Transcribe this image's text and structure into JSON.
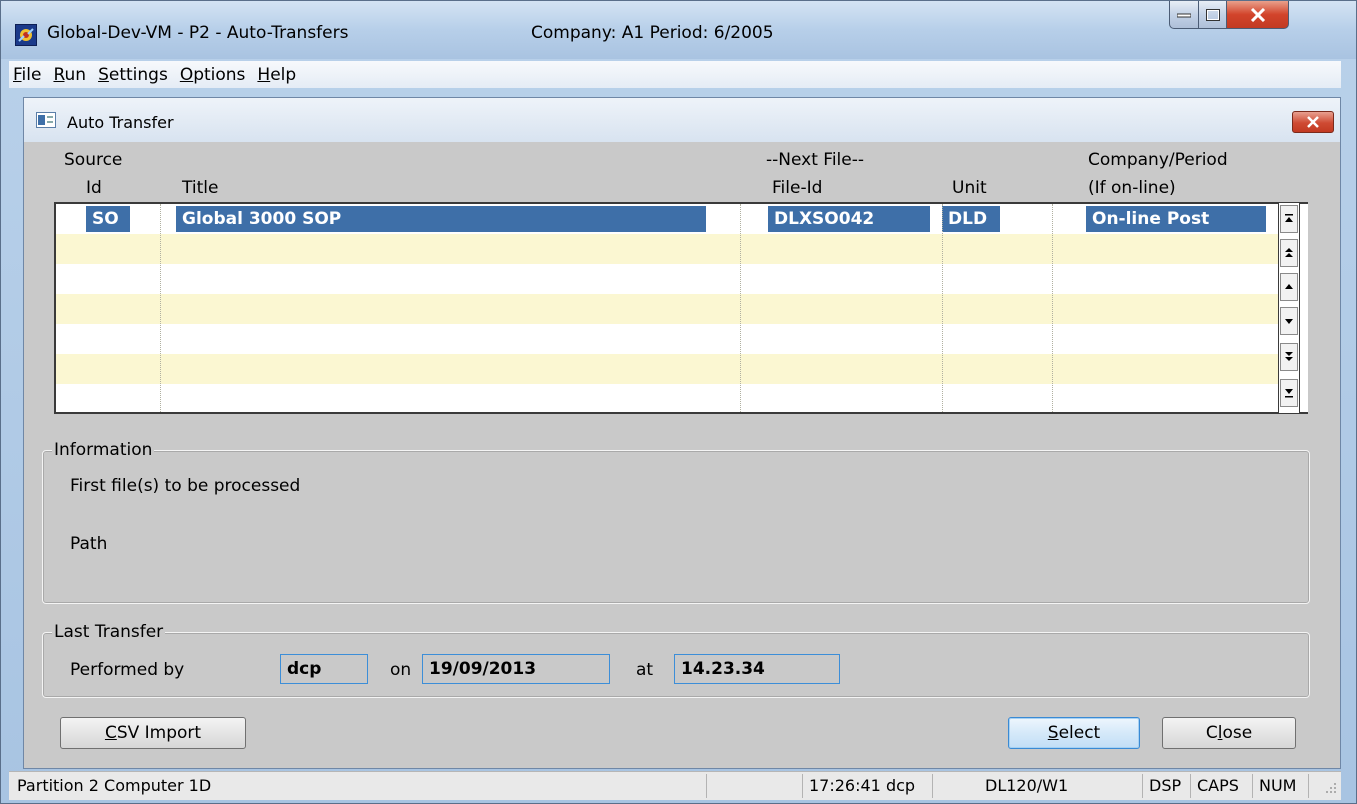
{
  "window": {
    "title": "Global-Dev-VM - P2 - Auto-Transfers",
    "company_period": "Company: A1  Period: 6/2005"
  },
  "menu": {
    "items": [
      {
        "first": "F",
        "rest": "ile"
      },
      {
        "first": "R",
        "rest": "un"
      },
      {
        "first": "S",
        "rest": "ettings"
      },
      {
        "first": "O",
        "rest": "ptions"
      },
      {
        "first": "H",
        "rest": "elp"
      }
    ]
  },
  "dialog": {
    "title": "Auto Transfer",
    "headers": {
      "source": "Source",
      "id": "Id",
      "title": "Title",
      "next_file": "--Next File--",
      "file_id": "File-Id",
      "unit": "Unit",
      "company_period": "Company/Period",
      "if_online": "(If on-line)"
    },
    "rows": [
      {
        "id": "SO",
        "title": "Global 3000 SOP",
        "file_id": "DLXSO042",
        "unit": "DLD",
        "company_period": "On-line Post"
      }
    ],
    "information": {
      "label": "Information",
      "first_files": "First file(s) to be processed",
      "path": "Path"
    },
    "last_transfer": {
      "label": "Last Transfer",
      "performed_by_label": "Performed by",
      "performed_by": "dcp",
      "on_label": "on",
      "date": "19/09/2013",
      "at_label": "at",
      "time": "14.23.34"
    },
    "buttons": {
      "csv_first": "C",
      "csv_rest": "SV Import",
      "select_first": "S",
      "select_rest": "elect",
      "close_pre": "C",
      "close_u": "l",
      "close_rest": "ose"
    }
  },
  "status": {
    "partition": "Partition 2 Computer 1D",
    "time_user": "17:26:41 dcp",
    "terminal": "DL120/W1",
    "dsp": "DSP",
    "caps": "CAPS",
    "num": "NUM"
  },
  "colors": {
    "selection": "#3e6fa8",
    "row_alt": "#fbf7d2",
    "field_border": "#3c8ed8",
    "close_red": "#c23a22"
  }
}
